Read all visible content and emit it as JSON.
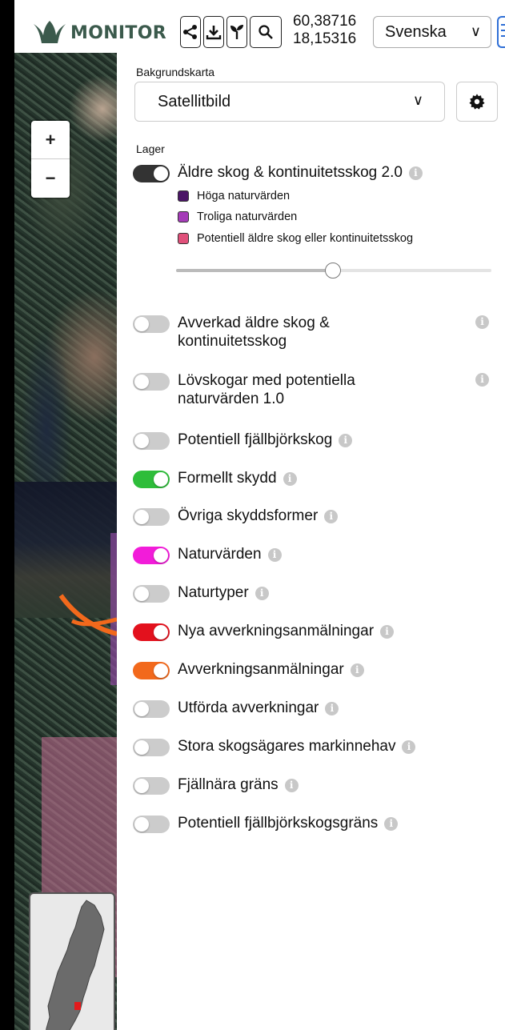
{
  "header": {
    "logo_text": "MONITOR",
    "coord_lat": "60,38716",
    "coord_lon": "18,15316",
    "language": "Svenska",
    "tools": [
      "share-icon",
      "download-icon",
      "sprout-icon",
      "search-icon"
    ]
  },
  "map": {
    "zoom_in": "+",
    "zoom_out": "−"
  },
  "panel": {
    "basemap_label": "Bakgrundskarta",
    "basemap_value": "Satellitbild",
    "layers_label": "Lager",
    "layers": [
      {
        "label": "Äldre skog & kontinuitetsskog 2.0",
        "on": true,
        "color": "#333333"
      },
      {
        "label": "Avverkad äldre skog & kontinuitetsskog",
        "on": false,
        "color": "#cccccc"
      },
      {
        "label": "Lövskogar med potentiella naturvärden 1.0",
        "on": false,
        "color": "#cccccc"
      },
      {
        "label": "Potentiell fjällbjörkskog",
        "on": false,
        "color": "#cccccc"
      },
      {
        "label": "Formellt skydd",
        "on": true,
        "color": "#2ebd3a"
      },
      {
        "label": "Övriga skyddsformer",
        "on": false,
        "color": "#cccccc"
      },
      {
        "label": "Naturvärden",
        "on": true,
        "color": "#f21cd9"
      },
      {
        "label": "Naturtyper",
        "on": false,
        "color": "#cccccc"
      },
      {
        "label": "Nya avverkningsanmälningar",
        "on": true,
        "color": "#e3111d"
      },
      {
        "label": "Avverkningsanmälningar",
        "on": true,
        "color": "#f2691c"
      },
      {
        "label": "Utförda avverkningar",
        "on": false,
        "color": "#cccccc"
      },
      {
        "label": "Stora skogsägares markinnehav",
        "on": false,
        "color": "#cccccc"
      },
      {
        "label": "Fjällnära gräns",
        "on": false,
        "color": "#cccccc"
      },
      {
        "label": "Potentiell fjällbjörkskogsgräns",
        "on": false,
        "color": "#cccccc"
      }
    ],
    "legend": [
      {
        "label": "Höga naturvärden",
        "color": "#4b1566"
      },
      {
        "label": "Troliga naturvärden",
        "color": "#a53cb8"
      },
      {
        "label": "Potentiell äldre skog eller kontinuitetsskog",
        "color": "#e0507a"
      }
    ],
    "opacity_slider": 0.5
  }
}
